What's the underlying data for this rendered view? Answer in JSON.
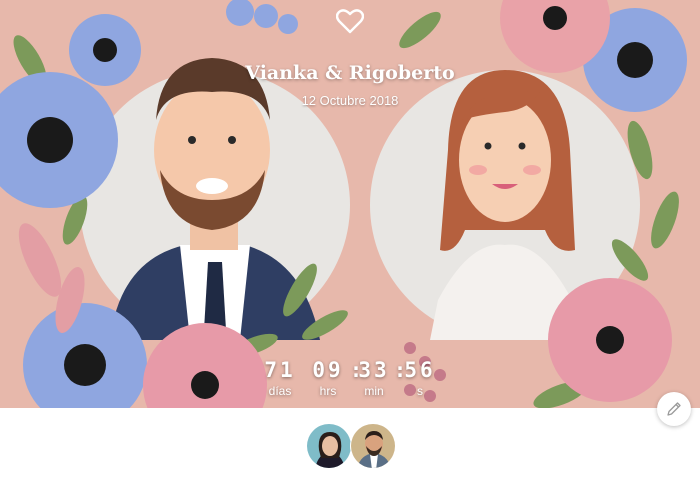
{
  "header": {
    "icon": "heart-icon",
    "couple_names": "Vianka & Rigoberto",
    "wedding_date": "12 Octubre 2018"
  },
  "countdown": {
    "days": "71",
    "days_label": "días",
    "hours": "09",
    "hours_label": "hrs",
    "minutes": "33",
    "minutes_label": "min",
    "seconds": "56",
    "seconds_label": "s",
    "separator": ":"
  },
  "actions": {
    "edit_icon": "pencil-icon"
  },
  "avatars": [
    {
      "name": "avatar-bride"
    },
    {
      "name": "avatar-groom"
    }
  ],
  "colors": {
    "background": "#e7b8ab",
    "text": "#ffffff",
    "accent_blue": "#8fa6e0",
    "accent_pink": "#e79aa8",
    "leaf_green": "#7c9a5a"
  }
}
